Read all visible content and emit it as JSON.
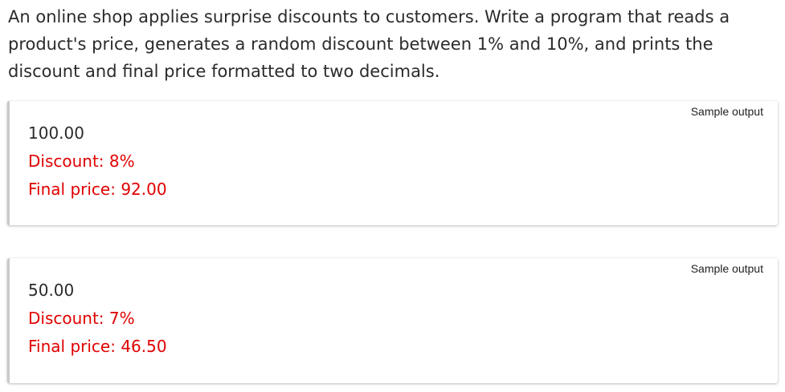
{
  "problem": {
    "text": "An online shop applies surprise discounts to customers. Write a program that reads a product's price, generates a random discount between 1% and 10%, and prints the discount and final price formatted to two decimals."
  },
  "samples": [
    {
      "label": "Sample output",
      "input": "100.00",
      "discount": "Discount: 8%",
      "final_price": "Final price: 92.00"
    },
    {
      "label": "Sample output",
      "input": "50.00",
      "discount": "Discount: 7%",
      "final_price": "Final price: 46.50"
    }
  ],
  "colors": {
    "text": "#2b2b2b",
    "output": "#e00000"
  }
}
